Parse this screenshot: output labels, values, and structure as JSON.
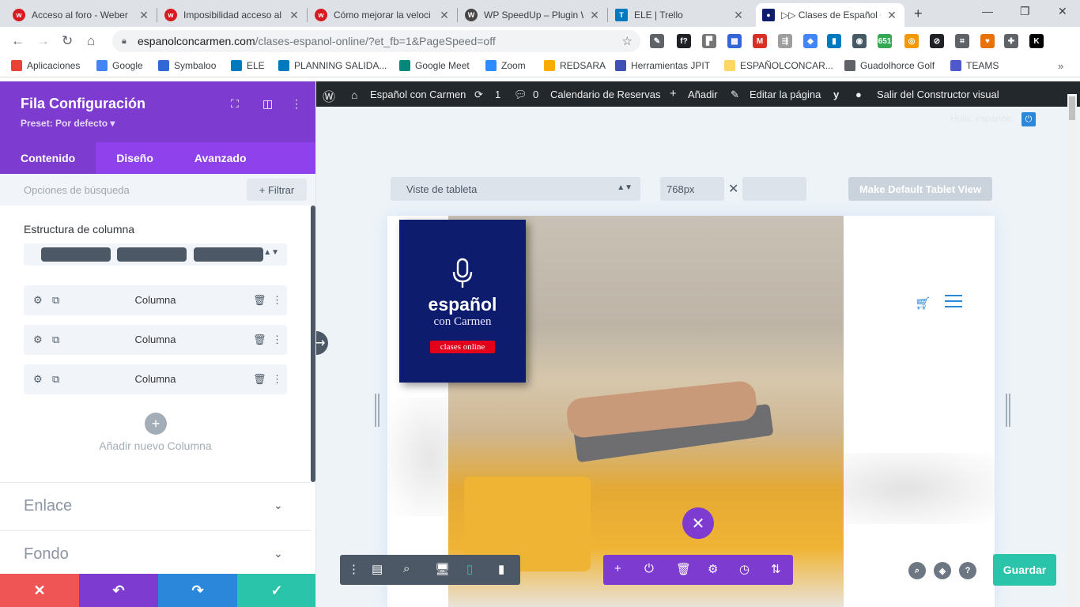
{
  "browser": {
    "tabs": [
      {
        "title": "Acceso al foro - Weber",
        "color": "#d71921",
        "glyph": "w"
      },
      {
        "title": "Imposibilidad acceso al",
        "color": "#d71921",
        "glyph": "w"
      },
      {
        "title": "Cómo mejorar la veloci",
        "color": "#d71921",
        "glyph": "w"
      },
      {
        "title": "WP SpeedUp – Plugin W",
        "color": "#464646",
        "glyph": "W"
      },
      {
        "title": "ELE | Trello",
        "color": "#0079bf",
        "glyph": "T"
      },
      {
        "title": "▷▷ Clases de Español C",
        "color": "#0e1c6e",
        "glyph": "●"
      }
    ],
    "url_host": "espanolconcarmen.com",
    "url_path": "/clases-espanol-online/?et_fb=1&PageSpeed=off",
    "bookmarks": [
      {
        "label": "Aplicaciones",
        "color": "#ea4335"
      },
      {
        "label": "Google",
        "color": "#4285f4"
      },
      {
        "label": "Symbaloo",
        "color": "#3367d6"
      },
      {
        "label": "ELE",
        "color": "#0079bf"
      },
      {
        "label": "PLANNING SALIDA...",
        "color": "#0079bf"
      },
      {
        "label": "Google Meet",
        "color": "#00897b"
      },
      {
        "label": "Zoom",
        "color": "#2d8cff"
      },
      {
        "label": "REDSARA",
        "color": "#f9ab00"
      },
      {
        "label": "Herramientas JPIT",
        "color": "#3f51b5"
      },
      {
        "label": "ESPAÑOLCONCAR...",
        "color": "#fdd663"
      },
      {
        "label": "Guadolhorce Golf",
        "color": "#5f6368"
      },
      {
        "label": "TEAMS",
        "color": "#5059c9"
      }
    ],
    "extensions": [
      {
        "glyph": "✎",
        "color": "#5f6368"
      },
      {
        "glyph": "f?",
        "color": "#202124"
      },
      {
        "glyph": "▛",
        "color": "#757575"
      },
      {
        "glyph": "▦",
        "color": "#3367d6"
      },
      {
        "glyph": "M",
        "color": "#d93025"
      },
      {
        "glyph": "⇶",
        "color": "#9e9e9e"
      },
      {
        "glyph": "◆",
        "color": "#4285f4"
      },
      {
        "glyph": "▮",
        "color": "#0079bf"
      },
      {
        "glyph": "◉",
        "color": "#455a64"
      },
      {
        "glyph": "651",
        "color": "#34a853"
      },
      {
        "glyph": "◎",
        "color": "#f29900"
      },
      {
        "glyph": "⊘",
        "color": "#202124"
      },
      {
        "glyph": "⌗",
        "color": "#5f6368"
      },
      {
        "glyph": "♥",
        "color": "#e8710a"
      },
      {
        "glyph": "✚",
        "color": "#5f6368"
      },
      {
        "glyph": "K",
        "color": "#000000"
      }
    ]
  },
  "panel": {
    "title": "Fila Configuración",
    "preset": "Preset: Por defecto ▾",
    "tabs": [
      "Contenido",
      "Diseño",
      "Avanzado"
    ],
    "search_label": "Opciones de búsqueda",
    "filter_label": "+ Filtrar",
    "structure_title": "Estructura de columna",
    "columns": [
      "Columna",
      "Columna",
      "Columna"
    ],
    "add_column": "Añadir nuevo Columna",
    "toggles": [
      "Enlace",
      "Fondo"
    ]
  },
  "wp_admin": {
    "site": "Español con Carmen",
    "updates": "1",
    "comments": "0",
    "calendar": "Calendario de Reservas",
    "add": "Añadir",
    "edit": "Editar la página",
    "exit": "Salir del Constructor visual",
    "user": "Hola, espanolc"
  },
  "builder": {
    "view_select": "Viste de tableta",
    "width_value": "768px",
    "height_value": "",
    "default_button": "Make Default Tablet View",
    "save": "Guardar"
  },
  "site": {
    "logo_main": "español",
    "logo_sub": "con Carmen",
    "logo_badge": "clases online"
  },
  "colors": {
    "accent_purple": "#7e3bd0",
    "tab_purple": "#8f42ec",
    "save_green": "#29c4a9",
    "cancel_red": "#ef5555",
    "redo_blue": "#2b87da",
    "logo_navy": "#0e1c6e"
  }
}
